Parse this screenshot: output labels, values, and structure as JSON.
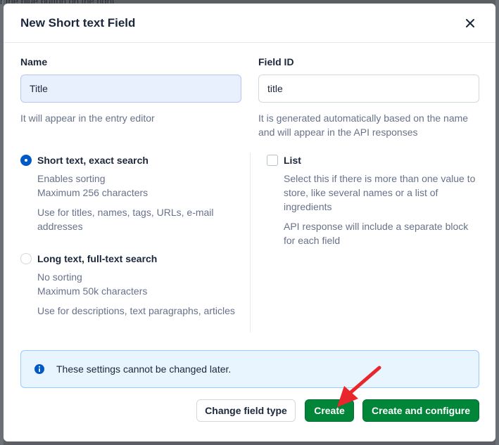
{
  "background": {
    "text": "r the blue button on the right"
  },
  "dialog": {
    "title": "New Short text Field",
    "name_label": "Name",
    "name_value": "Title",
    "name_help": "It will appear in the entry editor",
    "id_label": "Field ID",
    "id_value": "title",
    "id_help": "It is generated automatically based on the name and will appear in the API responses"
  },
  "options": {
    "short": {
      "label": "Short text, exact search",
      "selected": true,
      "desc1": "Enables sorting",
      "desc2": "Maximum 256 characters",
      "desc3": "Use for titles, names, tags, URLs, e-mail addresses"
    },
    "long": {
      "label": "Long text, full-text search",
      "selected": false,
      "desc1": "No sorting",
      "desc2": "Maximum 50k characters",
      "desc3": "Use for descriptions, text paragraphs, articles"
    },
    "list": {
      "label": "List",
      "checked": false,
      "desc1": "Select this if there is more than one value to store, like several names or a list of ingredients",
      "desc2": "API response will include a separate block for each field"
    }
  },
  "note": {
    "text": "These settings cannot be changed later."
  },
  "buttons": {
    "change_type": "Change field type",
    "create": "Create",
    "create_configure": "Create and configure"
  },
  "colors": {
    "primary_green": "#008539",
    "info_blue": "#0059c8",
    "annotation_red": "#e8262b"
  }
}
